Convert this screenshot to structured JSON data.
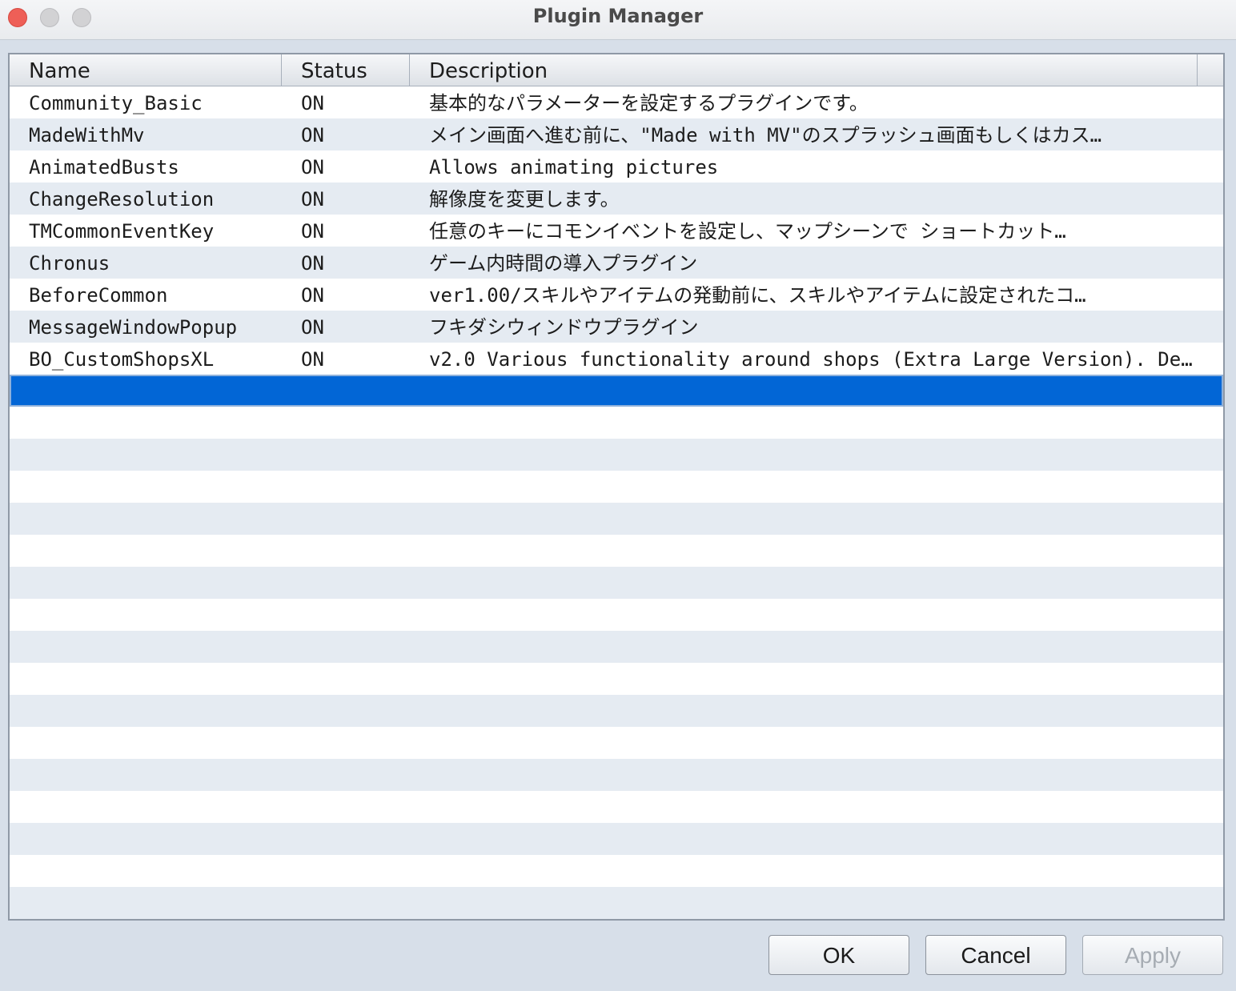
{
  "window": {
    "title": "Plugin Manager"
  },
  "table": {
    "headers": {
      "name": "Name",
      "status": "Status",
      "description": "Description"
    },
    "rows": [
      {
        "name": "Community_Basic",
        "status": "ON",
        "description": "基本的なパラメーターを設定するプラグインです。"
      },
      {
        "name": "MadeWithMv",
        "status": "ON",
        "description": "メイン画面へ進む前に、\"Made with MV\"のスプラッシュ画面もしくはカス…"
      },
      {
        "name": "AnimatedBusts",
        "status": "ON",
        "description": "Allows animating pictures"
      },
      {
        "name": "ChangeResolution",
        "status": "ON",
        "description": "解像度を変更します。"
      },
      {
        "name": "TMCommonEventKey",
        "status": "ON",
        "description": "任意のキーにコモンイベントを設定し、マップシーンで ショートカット…"
      },
      {
        "name": "Chronus",
        "status": "ON",
        "description": "ゲーム内時間の導入プラグイン"
      },
      {
        "name": "BeforeCommon",
        "status": "ON",
        "description": "ver1.00/スキルやアイテムの発動前に、スキルやアイテムに設定されたコ…"
      },
      {
        "name": "MessageWindowPopup",
        "status": "ON",
        "description": "フキダシウィンドウプラグイン"
      },
      {
        "name": "BO_CustomShopsXL",
        "status": "ON",
        "description": "v2.0 Various functionality around shops (Extra Large Version). Def…"
      }
    ],
    "selected_row": 9
  },
  "buttons": {
    "ok": "OK",
    "cancel": "Cancel",
    "apply": "Apply"
  }
}
